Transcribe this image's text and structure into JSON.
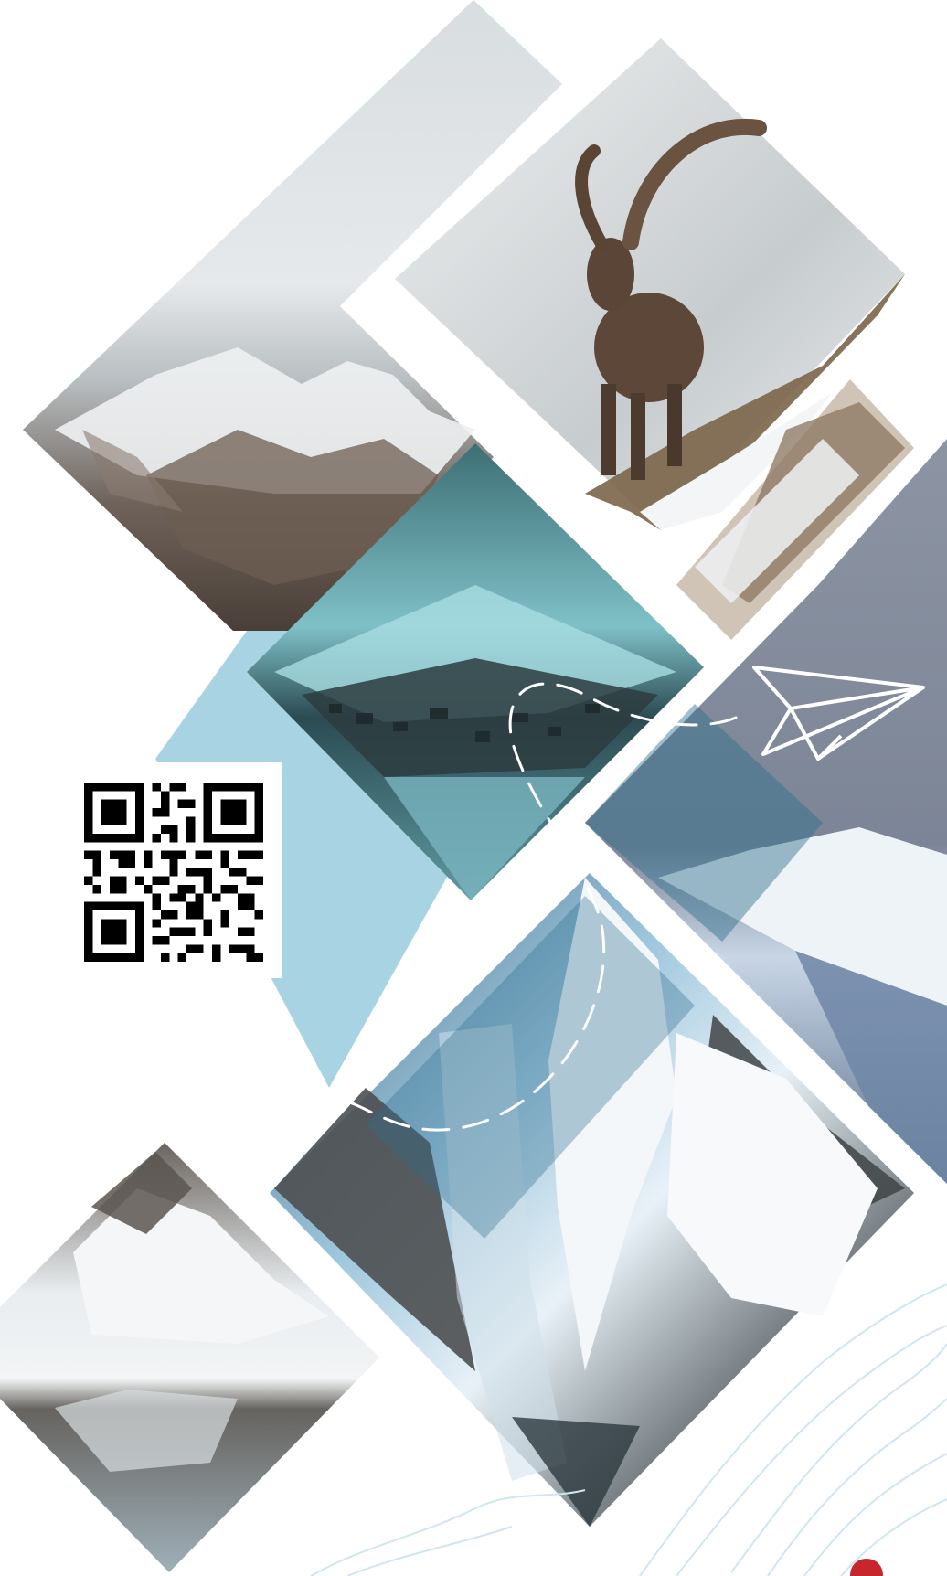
{
  "page": {
    "title": ""
  },
  "colors": {
    "background": "#ffffff",
    "accent_light_blue": "#a8d3e3",
    "overlay_blue": "#2d6e8c",
    "contour_lines": "#cfe6f0",
    "red_mark": "#c7262c"
  },
  "icons": {
    "paper_plane": "paper-plane-icon",
    "flight_path": "dashed-flight-path",
    "qr": "qr-code"
  },
  "photos": [
    {
      "name": "snowy-mountain-valley-photo",
      "description_visible": false
    },
    {
      "name": "alpine-ibex-photo",
      "description_visible": false
    },
    {
      "name": "snowy-village-photo",
      "description_visible": false
    },
    {
      "name": "snowy-hill-dusk-photo",
      "description_visible": false
    },
    {
      "name": "frozen-waterfall-photo",
      "description_visible": false
    },
    {
      "name": "mountain-lake-reflection-photo",
      "description_visible": false
    }
  ]
}
